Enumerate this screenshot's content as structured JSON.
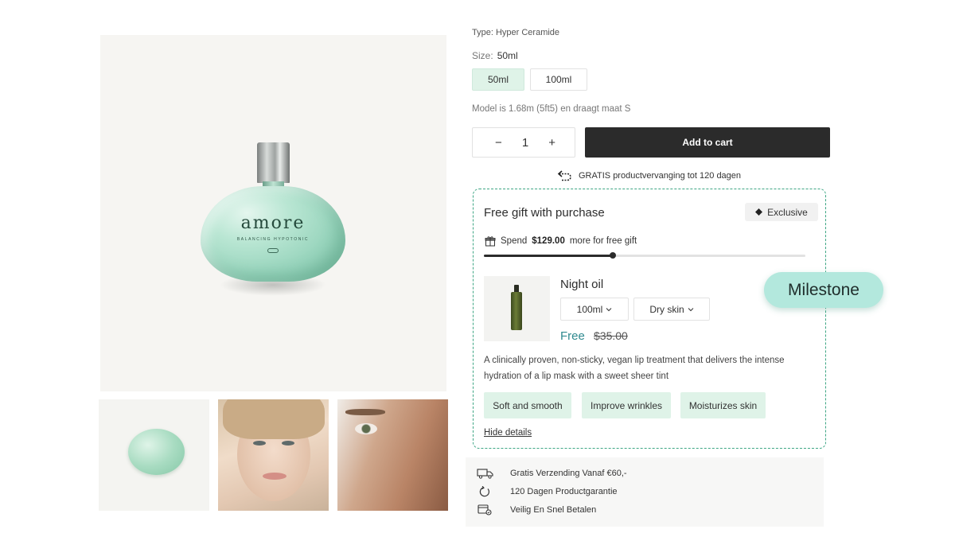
{
  "product": {
    "breadcrumb": "Type: Hyper Ceramide",
    "size_label": "Size:",
    "size_selected": "50ml",
    "size_options": [
      "50ml",
      "100ml"
    ],
    "model_note": "Model is 1.68m (5ft5) en draagt maat S",
    "quantity": "1",
    "qty_minus": "−",
    "qty_plus": "+",
    "add_to_cart": "Add to cart",
    "replacement_note": "GRATIS productvervanging tot 120 dagen",
    "bottle_brand": "amore",
    "bottle_subtitle": "BALANCING HYPOTONIC"
  },
  "gift": {
    "title": "Free gift with purchase",
    "badge": "Exclusive",
    "spend_prefix": "Spend",
    "spend_amount": "$129.00",
    "spend_suffix": "more for free gift",
    "progress_fraction": 0.4,
    "item": {
      "name": "Night oil",
      "size_select": "100ml",
      "skin_select": "Dry skin",
      "price": "Free",
      "old_price": "$35.00",
      "description": "A clinically proven, non-sticky, vegan lip treatment that delivers the intense hydration of a lip mask with a sweet sheer tint",
      "tags": [
        "Soft and smooth",
        "Improve wrinkles",
        "Moisturizes skin"
      ],
      "hide_link": "Hide details"
    }
  },
  "milestone_label": "Milestone",
  "usp": [
    {
      "icon": "truck-icon",
      "text": "Gratis Verzending Vanaf €60,-"
    },
    {
      "icon": "refresh-icon",
      "text": "120 Dagen Productgarantie"
    },
    {
      "icon": "secure-payment-icon",
      "text": "Veilig En Snel Betalen"
    }
  ],
  "colors": {
    "accent_green": "#dff3e8",
    "dashed_border": "#3ea684",
    "milestone_bg": "#b3e8dd",
    "button_dark": "#2b2b2b",
    "free_price": "#2f8a8f"
  }
}
